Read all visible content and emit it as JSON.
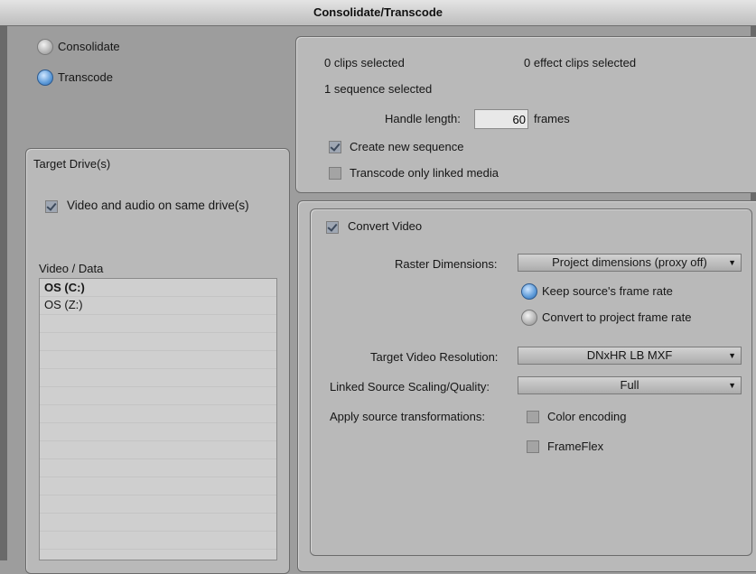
{
  "window": {
    "title": "Consolidate/Transcode"
  },
  "mode": {
    "consolidate_label": "Consolidate",
    "transcode_label": "Transcode",
    "selected": "Transcode"
  },
  "target_drives": {
    "title": "Target Drive(s)",
    "same_drive_label": "Video and audio on same drive(s)",
    "same_drive_checked": true,
    "list_header": "Video / Data",
    "drives": [
      "OS (C:)",
      "OS (Z:)"
    ],
    "selected_drive": "OS (C:)"
  },
  "selection_info": {
    "clips": "0 clips selected",
    "effect_clips": "0 effect clips selected",
    "sequences": "1 sequence selected",
    "handle_label": "Handle length:",
    "handle_value": "60",
    "handle_unit": "frames",
    "create_new_sequence_label": "Create new sequence",
    "create_new_sequence_checked": true,
    "transcode_linked_label": "Transcode only linked media",
    "transcode_linked_checked": false
  },
  "convert_video": {
    "label": "Convert Video",
    "checked": true,
    "raster_label": "Raster Dimensions:",
    "raster_value": "Project dimensions (proxy off)",
    "keep_rate_label": "Keep source's frame rate",
    "convert_rate_label": "Convert to project frame rate",
    "frame_rate_selected": "keep",
    "resolution_label": "Target Video Resolution:",
    "resolution_value": "DNxHR LB  MXF",
    "scaling_label": "Linked Source Scaling/Quality:",
    "scaling_value": "Full",
    "transform_label": "Apply source transformations:",
    "color_encoding_label": "Color encoding",
    "color_encoding_checked": false,
    "frameflex_label": "FrameFlex",
    "frameflex_checked": false
  }
}
